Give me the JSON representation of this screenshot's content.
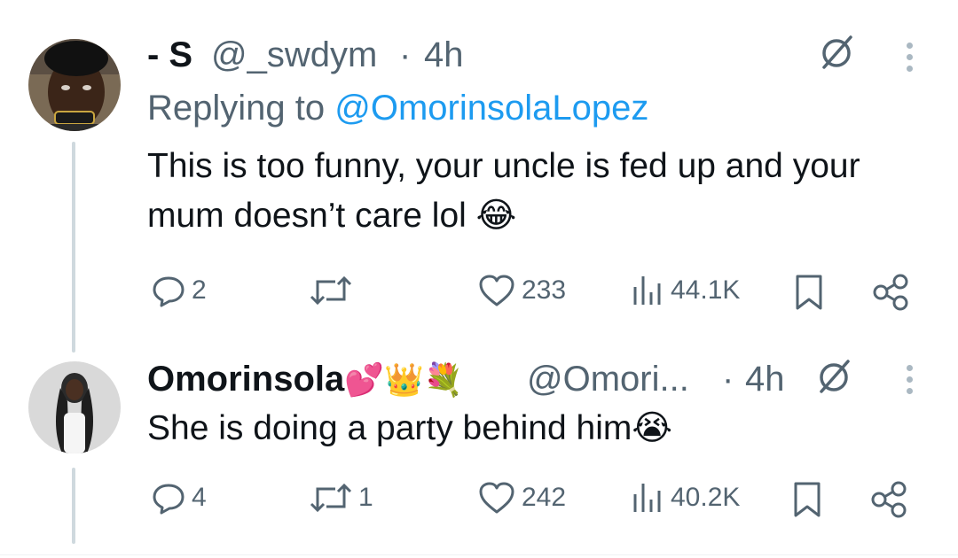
{
  "tweets": [
    {
      "name": "- S",
      "handle": "@_swdym",
      "separator": "·",
      "time": "4h",
      "reply_prefix": "Replying to ",
      "reply_handle": "@OmorinsolaLopez",
      "text": "This is too funny, your uncle is fed up and your mum doesn’t care lol",
      "text_emoji": "😂",
      "replies": "2",
      "retweets": "",
      "likes": "233",
      "views": "44.1K"
    },
    {
      "name": "Omorinsola",
      "name_emojis": "💕👑💐",
      "handle": "@Omori...",
      "separator": "·",
      "time": "4h",
      "text": "She is doing a party behind him",
      "text_emoji": "😭",
      "replies": "4",
      "retweets": "1",
      "likes": "242",
      "views": "40.2K"
    }
  ],
  "icons": [
    "grok-icon",
    "more-icon",
    "reply-icon",
    "retweet-icon",
    "like-icon",
    "views-icon",
    "bookmark-icon",
    "share-icon"
  ],
  "colors": {
    "link": "#1d9bf0",
    "muted": "#536471",
    "thread_line": "#cfd9de",
    "text": "#0f1419"
  }
}
